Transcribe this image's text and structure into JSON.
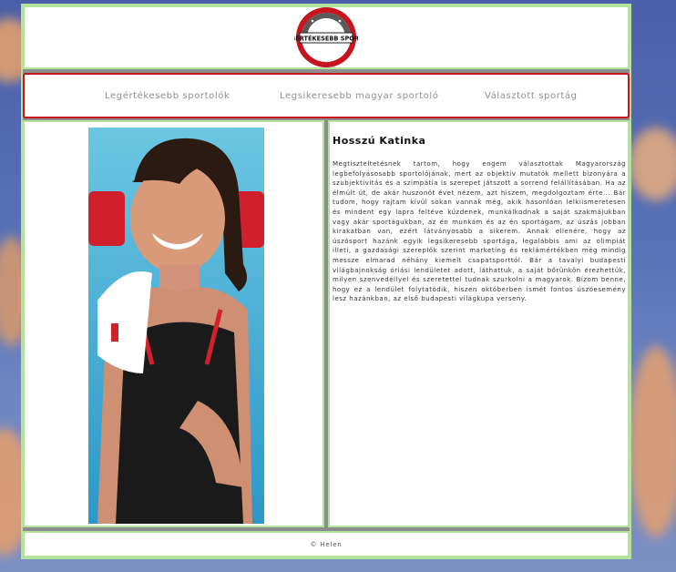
{
  "header": {
    "logo": {
      "icon": "site-logo-badge",
      "text": "A LEGÉRTÉKESEBB SPORTOLÓ",
      "colors": {
        "ring_outer": "#c6151f",
        "ring_inner": "#555555",
        "badge": "#ffffff"
      }
    }
  },
  "nav": {
    "items": [
      {
        "label": "Legértékesebb sportolók"
      },
      {
        "label": "Legsikeresebb magyar sportoló"
      },
      {
        "label": "Választott sportág"
      }
    ]
  },
  "article": {
    "title": "Hosszú Katinka",
    "body": "Megtiszteltetésnek tartom, hogy engem választottak Magyarország legbefolyásosabb sportolójának, mert az objektív mutatók mellett bizonyára a szubjektivitás és a szimpátia is szerepet játszott a sorrend felállításában. Ha az élmúlt út, de akár huszonöt évet nézem, azt hiszem, megdolgoztam érte... Bár tudom, hogy rajtam kívül sokan vannak még, akik hasonlóan lelkiismeretesen és mindent egy lapra feltéve küzdenek, munkálkodnak a saját szakmájukban vagy akár sportágukban, az én munkám és az én sportágam, az úszás jobban kirakatban van, ezért látványosabb a sikerem. Annak ellenére, hogy az úszósport hazánk egyik legsikeresebb sportága, legalábbis ami az olimpiát illeti, a gazdasági szereplők szerint marketing és reklámértékben még mindig messze elmarad néhány kiemelt csapatsporttól. Bár a tavalyi budapesti világbajnokság óriási lendületet adott, láthattuk, a saját bőrünkön érezhettük, milyen szenvedéllyel és szeretettel tudnak szurkolni a magyarok. Bízom benne, hogy ez a lendület folytatódik, hiszen októberben ismét fontos úszóesemény lesz hazánkban, az első budapesti világkupa verseny."
  },
  "photo": {
    "subject": "swimmer-portrait-photo",
    "colors": {
      "pool": "#46b5d8",
      "swimsuit": "#1a1a1a",
      "accent": "#d0202c"
    }
  },
  "footer": {
    "text": "© Helen"
  },
  "theme": {
    "border": "#b4e39c",
    "nav_border": "#c6151f",
    "panel_bg": "#ffffff"
  }
}
